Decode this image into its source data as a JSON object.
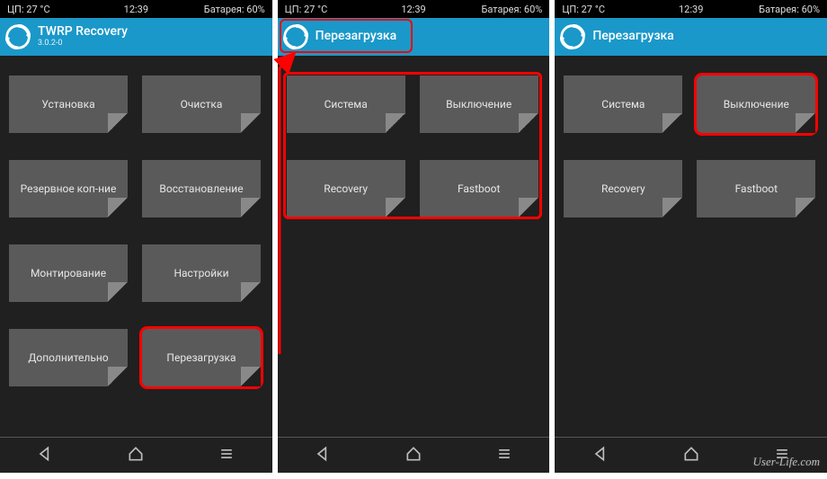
{
  "status": {
    "cpu": "ЦП: 27 °C",
    "time": "12:39",
    "battery": "Батарея: 60%"
  },
  "screen1": {
    "title": "TWRP Recovery",
    "version": "3.0.2-0",
    "tiles": [
      [
        "Установка",
        "Очистка"
      ],
      [
        "Резервное коп-ние",
        "Восстановление"
      ],
      [
        "Монтирование",
        "Настройки"
      ],
      [
        "Дополнительно",
        "Перезагрузка"
      ]
    ],
    "highlight": [
      3,
      1
    ]
  },
  "screen2": {
    "title": "Перезагрузка",
    "tiles": [
      [
        "Система",
        "Выключение"
      ],
      [
        "Recovery",
        "Fastboot"
      ]
    ],
    "header_highlight": true,
    "box_all": true
  },
  "screen3": {
    "title": "Перезагрузка",
    "tiles": [
      [
        "Система",
        "Выключение"
      ],
      [
        "Recovery",
        "Fastboot"
      ]
    ],
    "highlight": [
      0,
      1
    ]
  },
  "watermark": "User-Life.com"
}
